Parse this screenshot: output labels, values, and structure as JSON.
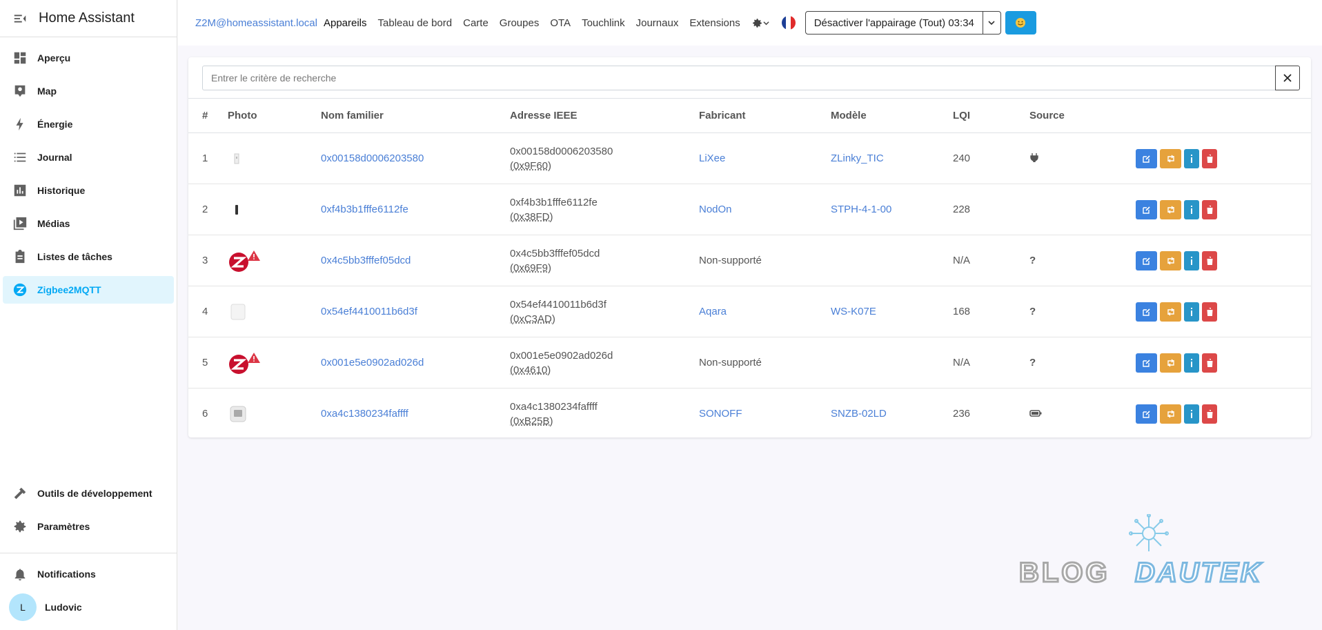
{
  "sidebar": {
    "title": "Home Assistant",
    "items": [
      {
        "label": "Aperçu",
        "icon": "dashboard-icon"
      },
      {
        "label": "Map",
        "icon": "map-icon"
      },
      {
        "label": "Énergie",
        "icon": "lightning-icon"
      },
      {
        "label": "Journal",
        "icon": "list-icon"
      },
      {
        "label": "Historique",
        "icon": "chart-icon"
      },
      {
        "label": "Médias",
        "icon": "media-icon"
      },
      {
        "label": "Listes de tâches",
        "icon": "clipboard-icon"
      },
      {
        "label": "Zigbee2MQTT",
        "icon": "zigbee-icon",
        "active": true
      }
    ],
    "tools_label": "Outils de développement",
    "settings_label": "Paramètres",
    "notifications_label": "Notifications",
    "user_name": "Ludovic",
    "user_initial": "L"
  },
  "topbar": {
    "brand": "Z2M@homeassistant.local",
    "nav": [
      "Appareils",
      "Tableau de bord",
      "Carte",
      "Groupes",
      "OTA",
      "Touchlink",
      "Journaux",
      "Extensions"
    ],
    "pairing_button": "Désactiver l'appairage (Tout) 03:34"
  },
  "search": {
    "placeholder": "Entrer le critère de recherche"
  },
  "table": {
    "headers": [
      "#",
      "Photo",
      "Nom familier",
      "Adresse IEEE",
      "Fabricant",
      "Modèle",
      "LQI",
      "Source"
    ],
    "rows": [
      {
        "num": "1",
        "name": "0x00158d0006203580",
        "ieee": "0x00158d0006203580",
        "nwk": "(0x9F60)",
        "vendor": "LiXee",
        "model": "ZLinky_TIC",
        "lqi": "240",
        "source": "plug-icon"
      },
      {
        "num": "2",
        "name": "0xf4b3b1fffe6112fe",
        "ieee": "0xf4b3b1fffe6112fe",
        "nwk": "(0x38FD)",
        "vendor": "NodOn",
        "model": "STPH-4-1-00",
        "lqi": "228",
        "source": ""
      },
      {
        "num": "3",
        "name": "0x4c5bb3fffef05dcd",
        "ieee": "0x4c5bb3fffef05dcd",
        "nwk": "(0x69F9)",
        "vendor": "Non-supporté",
        "model": "",
        "lqi": "N/A",
        "source": "?"
      },
      {
        "num": "4",
        "name": "0x54ef4410011b6d3f",
        "ieee": "0x54ef4410011b6d3f",
        "nwk": "(0xC3AD)",
        "vendor": "Aqara",
        "model": "WS-K07E",
        "lqi": "168",
        "source": "?"
      },
      {
        "num": "5",
        "name": "0x001e5e0902ad026d",
        "ieee": "0x001e5e0902ad026d",
        "nwk": "(0x4610)",
        "vendor": "Non-supporté",
        "model": "",
        "lqi": "N/A",
        "source": "?"
      },
      {
        "num": "6",
        "name": "0xa4c1380234faffff",
        "ieee": "0xa4c1380234faffff",
        "nwk": "(0xB25B)",
        "vendor": "SONOFF",
        "model": "SNZB-02LD",
        "lqi": "236",
        "source": "battery-icon"
      }
    ]
  },
  "watermark": {
    "text_left": "BLOG",
    "text_right": "DAUTEK"
  },
  "colors": {
    "accent": "#03a9f4",
    "link": "#4a7fd6",
    "edit": "#3b82e0",
    "rename": "#e6a23c",
    "info": "#2895c8",
    "delete": "#dc4848"
  }
}
